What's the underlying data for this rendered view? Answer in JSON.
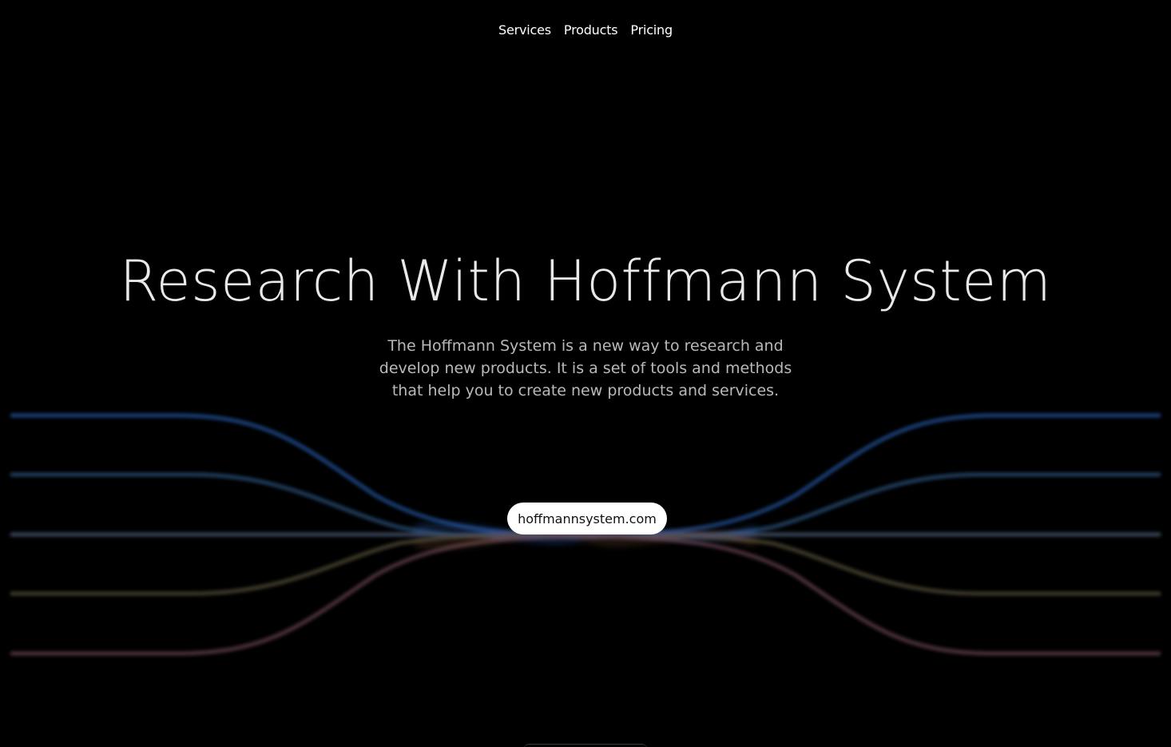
{
  "nav": {
    "items": [
      {
        "label": "Services"
      },
      {
        "label": "Products"
      },
      {
        "label": "Pricing"
      }
    ]
  },
  "hero": {
    "title": "Research With Hoffmann System",
    "subtitle": "The Hoffmann System is a new way to research and develop new products. It is a set of tools and methods that help you to create new products and services.",
    "cta_label": "hoffmannsystem.com"
  },
  "colors": {
    "background": "#000000",
    "wave_blue": "#1e4a8a",
    "wave_slate": "#2d4a6a",
    "wave_grey": "#3e4a5e",
    "wave_olive": "#4a4530",
    "wave_rose": "#5a3a40"
  }
}
